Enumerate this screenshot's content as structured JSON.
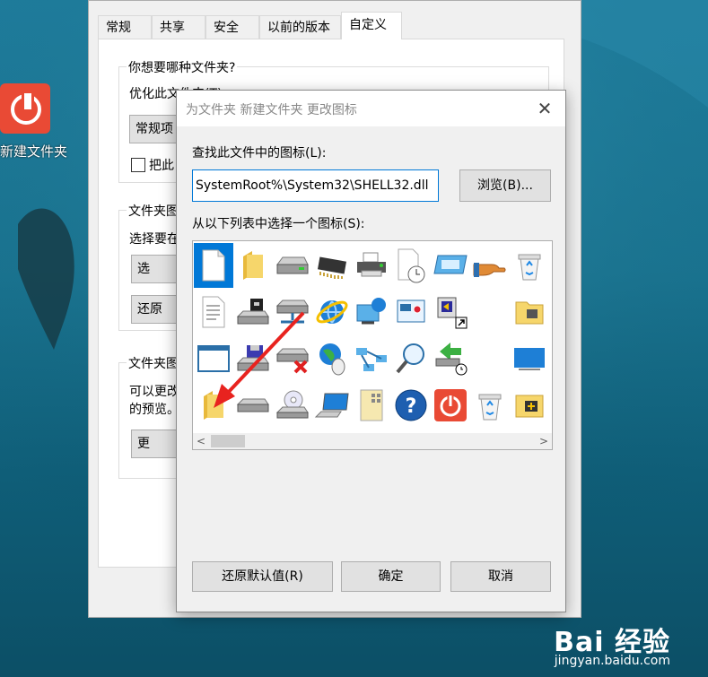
{
  "desktop": {
    "icon_label": "新建文件夹",
    "watermark_main": "Bai 经验",
    "watermark_sub": "jingyan.baidu.com"
  },
  "properties": {
    "tabs": [
      "常规",
      "共享",
      "安全",
      "以前的版本",
      "自定义"
    ],
    "active_tab": 4,
    "group1_title": "你想要哪种文件夹?",
    "optimize_label": "优化此文件夹(T):",
    "optimize_value": "常规项",
    "apply_subfolders": "把此",
    "group2_title": "文件夹图",
    "group2_text": "选择要在",
    "group2_btn1": "选",
    "group2_btn2": "还原",
    "group3_title": "文件夹图",
    "group3_text1": "可以更改",
    "group3_text2": "的预览。",
    "group3_btn": "更"
  },
  "dialog": {
    "title": "为文件夹 新建文件夹 更改图标",
    "find_label": "查找此文件中的图标(L):",
    "path_value": "SystemRoot%\\System32\\SHELL32.dll",
    "browse_label": "浏览(B)...",
    "list_label": "从以下列表中选择一个图标(S):",
    "restore_label": "还原默认值(R)",
    "ok_label": "确定",
    "cancel_label": "取消",
    "selected_icon": "blank-document-icon",
    "icons": [
      [
        "blank-document-icon",
        "folder-icon",
        "hard-drive-icon",
        "memory-chip-icon",
        "printer-icon",
        "document-clock-icon",
        "monitor-window-icon",
        "hand-pointing-icon",
        "recycle-bin-full-icon"
      ],
      [
        "text-document-icon",
        "drive-settings-icon",
        "network-drive-icon",
        "internet-explorer-icon",
        "network-globe-icon",
        "slideshow-icon",
        "display-shortcut-icon",
        "",
        ""
      ],
      [
        "window-icon",
        "floppy-drive-icon",
        "disconnected-drive-icon",
        "globe-mouse-icon",
        "network-nodes-icon",
        "magnifier-icon",
        "green-arrow-drive-icon",
        "",
        "blue-monitor-icon"
      ],
      [
        "open-folder-icon",
        "flat-drive-icon",
        "cd-drive-icon",
        "computer-icon",
        "grid-document-icon",
        "help-icon",
        "power-icon",
        "recycle-bin-empty-icon",
        "network-folder-icon"
      ]
    ]
  }
}
